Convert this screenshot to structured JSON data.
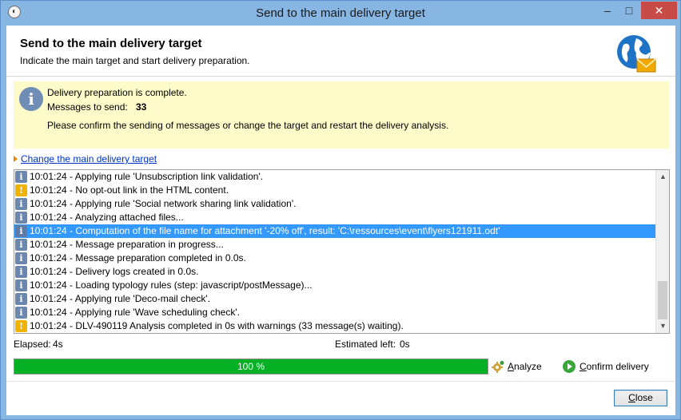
{
  "window": {
    "title": "Send to the main delivery target"
  },
  "header": {
    "title": "Send to the main delivery target",
    "subtitle": "Indicate the main target and start delivery preparation."
  },
  "info": {
    "status": "Delivery preparation is complete.",
    "messages_label": "Messages to send:",
    "messages_count": "33",
    "instruction": "Please confirm the sending of messages or change the target and restart the delivery analysis."
  },
  "change_target_link": "Change the main delivery target",
  "log": [
    {
      "type": "info",
      "text": "10:01:24 - Applying rule 'Unsubscription link validation'."
    },
    {
      "type": "warn",
      "text": "10:01:24 - No opt-out link in the HTML content."
    },
    {
      "type": "info",
      "text": "10:01:24 - Applying rule 'Social network sharing link validation'."
    },
    {
      "type": "info",
      "text": "10:01:24 - Analyzing attached files..."
    },
    {
      "type": "info",
      "text": "10:01:24 - Computation of the file name for attachment '-20% off', result: 'C:\\ressources\\event\\flyers121911.odt'",
      "selected": true
    },
    {
      "type": "info",
      "text": "10:01:24 - Message preparation in progress..."
    },
    {
      "type": "info",
      "text": "10:01:24 - Message preparation completed in 0.0s."
    },
    {
      "type": "info",
      "text": "10:01:24 - Delivery logs created in 0.0s."
    },
    {
      "type": "info",
      "text": "10:01:24 - Loading typology rules (step: javascript/postMessage)..."
    },
    {
      "type": "info",
      "text": "10:01:24 - Applying rule 'Deco-mail check'."
    },
    {
      "type": "info",
      "text": "10:01:24 - Applying rule 'Wave scheduling check'."
    },
    {
      "type": "warn",
      "text": "10:01:24 - DLV-490119 Analysis completed in 0s with warnings (33 message(s) waiting)."
    }
  ],
  "stats": {
    "elapsed_label": "Elapsed:",
    "elapsed_value": "4s",
    "estimated_label": "Estimated left:",
    "estimated_value": "0s"
  },
  "progress": {
    "percent": 100,
    "label": "100 %"
  },
  "buttons": {
    "analyze_first": "A",
    "analyze_rest": "nalyze",
    "confirm_first": "C",
    "confirm_rest": "onfirm delivery",
    "close_first": "C",
    "close_rest": "lose"
  },
  "colors": {
    "titlebar": "#88b6e3",
    "info_panel": "#fdfbc9",
    "selection": "#3399ff",
    "progress_fill": "#06b025",
    "link": "#0033cc"
  }
}
